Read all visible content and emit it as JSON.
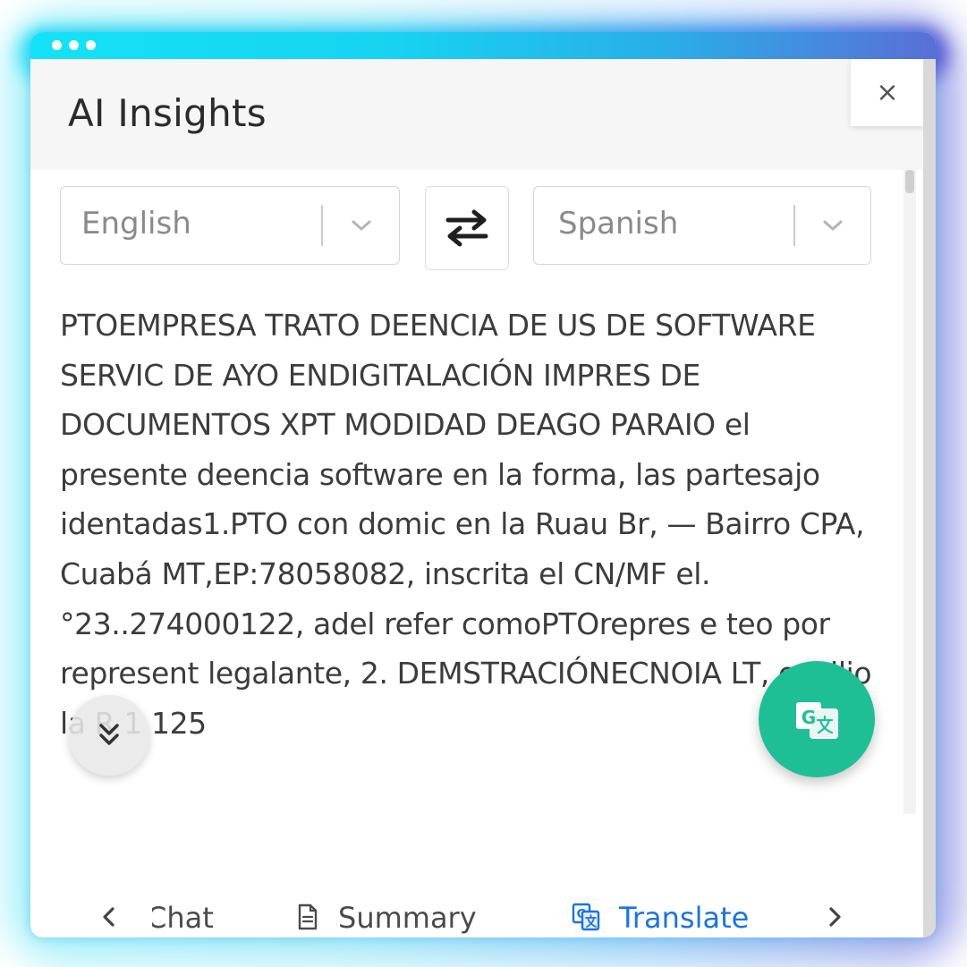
{
  "window": {
    "title": "AI Insights",
    "close_label": "×"
  },
  "translator": {
    "source_language": "English",
    "target_language": "Spanish",
    "output_text": "PTOEMPRESA TRATO DEENCIA DE US DE SOFTWARE SERVIC DE AYO ENDIGITALACIÓN IMPRES DE DOCUMENTOS XPT MODIDAD DEAGO PARAIO el presente deencia software en la forma, las partesajo identadas1.PTO con domic en la Ruau Br, — Bairro CPA, Cuabá MT,EP:78058082, inscrita el CN/MF el.°23..274000122, adel refer comoPTOrepres e teo por represent legalante, 2. DEMSTRACIÓNECNOIA LT, conilio la R 1 125"
  },
  "tabs": [
    {
      "label": "Chat",
      "icon": "chat-icon"
    },
    {
      "label": "Summary",
      "icon": "document-icon"
    },
    {
      "label": "Translate",
      "icon": "translate-icon"
    }
  ],
  "colors": {
    "accent_blue": "#1a73e8",
    "fab_green": "#1fbf96",
    "titlebar_cyan": "#14e2f7"
  }
}
